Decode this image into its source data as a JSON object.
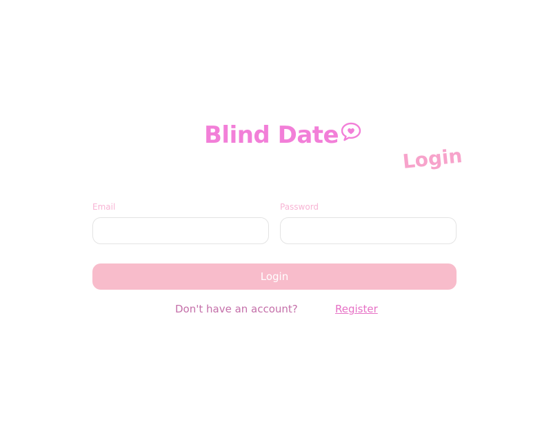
{
  "brand": {
    "title": "Blind Date",
    "icon": "chat-bubble-heart-icon"
  },
  "page": {
    "heading": "Login"
  },
  "form": {
    "email": {
      "label": "Email",
      "value": "",
      "placeholder": ""
    },
    "password": {
      "label": "Password",
      "value": "",
      "placeholder": ""
    },
    "submit_label": "Login"
  },
  "footer": {
    "prompt": "Don't have an account?",
    "register_label": "Register"
  },
  "colors": {
    "brand": "#f27fd8",
    "heading": "#f7a3cb",
    "label": "#f8b4d4",
    "button": "#f8bccb",
    "prompt": "#c46fa9",
    "link": "#e670c5",
    "input_border": "#e3e3e3"
  }
}
